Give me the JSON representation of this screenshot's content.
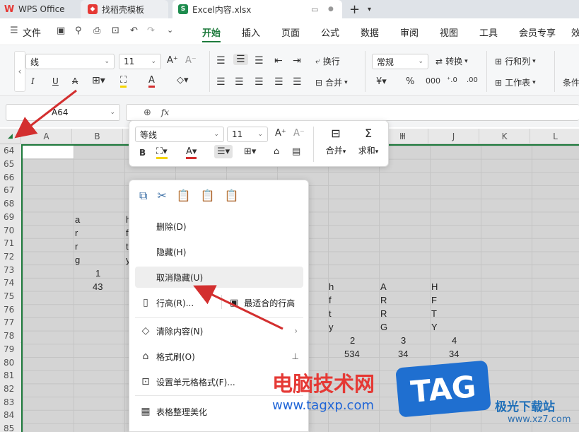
{
  "tabs": [
    {
      "label": "WPS Office",
      "icon": "wps-logo-icon",
      "color": "#e53935"
    },
    {
      "label": "找稻壳模板",
      "icon": "docer-icon",
      "color": "#e53935"
    },
    {
      "label": "Excel内容.xlsx",
      "icon": "spreadsheet-s-icon",
      "color": "#1e8c4e"
    }
  ],
  "menu": {
    "file": "文件",
    "items": [
      "开始",
      "插入",
      "页面",
      "公式",
      "数据",
      "审阅",
      "视图",
      "工具",
      "会员专享",
      "效"
    ],
    "active": "开始"
  },
  "ribbon": {
    "font_name": "线",
    "font_size": "11",
    "wrap": "换行",
    "merge": "合并",
    "number_format": "常规",
    "convert": "转换",
    "row_col": "行和列",
    "worksheet": "工作表",
    "cond": "条件"
  },
  "formula_bar": {
    "cell_ref": "A64",
    "fx": "fx"
  },
  "columns": [
    "A",
    "B",
    "C",
    "D",
    "E",
    "F",
    "G",
    "H",
    "I",
    "J",
    "K",
    "L"
  ],
  "rows": [
    "64",
    "65",
    "66",
    "67",
    "68",
    "69",
    "70",
    "71",
    "72",
    "73",
    "74",
    "75",
    "76",
    "77",
    "78",
    "79",
    "80",
    "81",
    "82",
    "83",
    "84",
    "85"
  ],
  "cells": {
    "b69": "a",
    "c69": "h",
    "b70": "r",
    "c70": "f",
    "b71": "r",
    "c71": "t",
    "b72": "g",
    "c72": "y",
    "b74": "1",
    "b75": "43",
    "h75": "h",
    "i75": "A",
    "j75": "H",
    "h76": "f",
    "i76": "R",
    "j76": "F",
    "h77": "t",
    "i77": "R",
    "j77": "T",
    "h78": "y",
    "i78": "G",
    "j78": "Y",
    "h79": "2",
    "i79": "3",
    "j79": "4",
    "h80": "534",
    "i80": "34",
    "j80": "34"
  },
  "mini_toolbar": {
    "font_name": "等线",
    "font_size": "11",
    "merge": "合并",
    "sum": "求和"
  },
  "context_menu": [
    {
      "label": "删除(D)",
      "icon": ""
    },
    {
      "label": "隐藏(H)",
      "icon": ""
    },
    {
      "label": "取消隐藏(U)",
      "icon": "",
      "highlighted": true
    },
    {
      "label": "行高(R)...",
      "icon": "row-height-icon",
      "extra": "最适合的行高"
    },
    {
      "label": "清除内容(N)",
      "icon": "eraser-icon",
      "submenu": true
    },
    {
      "label": "格式刷(O)",
      "icon": "format-painter-icon"
    },
    {
      "label": "设置单元格格式(F)...",
      "icon": "cell-format-icon"
    },
    {
      "label": "表格整理美化",
      "icon": "table-beautify-icon"
    }
  ],
  "watermark": {
    "cn": "电脑技术网",
    "url": "www.tagxp.com",
    "tag": "TAG",
    "site": "极光下载站",
    "site_url": "www.xz7.com"
  },
  "accent": "#1e7a3c",
  "arrow_color": "#d32f2f"
}
